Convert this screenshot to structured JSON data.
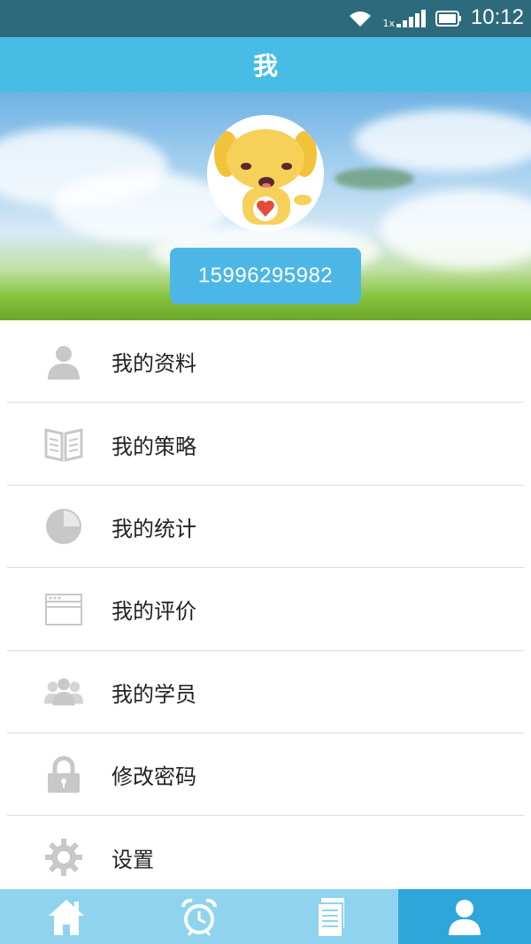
{
  "status_bar": {
    "time": "10:12",
    "sim_label": "1x"
  },
  "header": {
    "title": "我"
  },
  "profile": {
    "phone": "15996295982"
  },
  "menu": {
    "items": [
      {
        "label": "我的资料",
        "icon": "user-icon"
      },
      {
        "label": "我的策略",
        "icon": "book-icon"
      },
      {
        "label": "我的统计",
        "icon": "pie-chart-icon"
      },
      {
        "label": "我的评价",
        "icon": "window-icon"
      },
      {
        "label": "我的学员",
        "icon": "group-icon"
      },
      {
        "label": "修改密码",
        "icon": "lock-icon"
      },
      {
        "label": "设置",
        "icon": "gear-icon"
      }
    ]
  },
  "tabbar": {
    "tabs": [
      {
        "icon": "home-icon",
        "active": false
      },
      {
        "icon": "alarm-clock-icon",
        "active": false
      },
      {
        "icon": "document-icon",
        "active": false
      },
      {
        "icon": "person-icon",
        "active": true
      }
    ]
  },
  "colors": {
    "accent": "#47bde6",
    "status_bar": "#2d6a7c",
    "tab_active": "#2fa6da",
    "icon_gray": "#c8c8c8"
  }
}
